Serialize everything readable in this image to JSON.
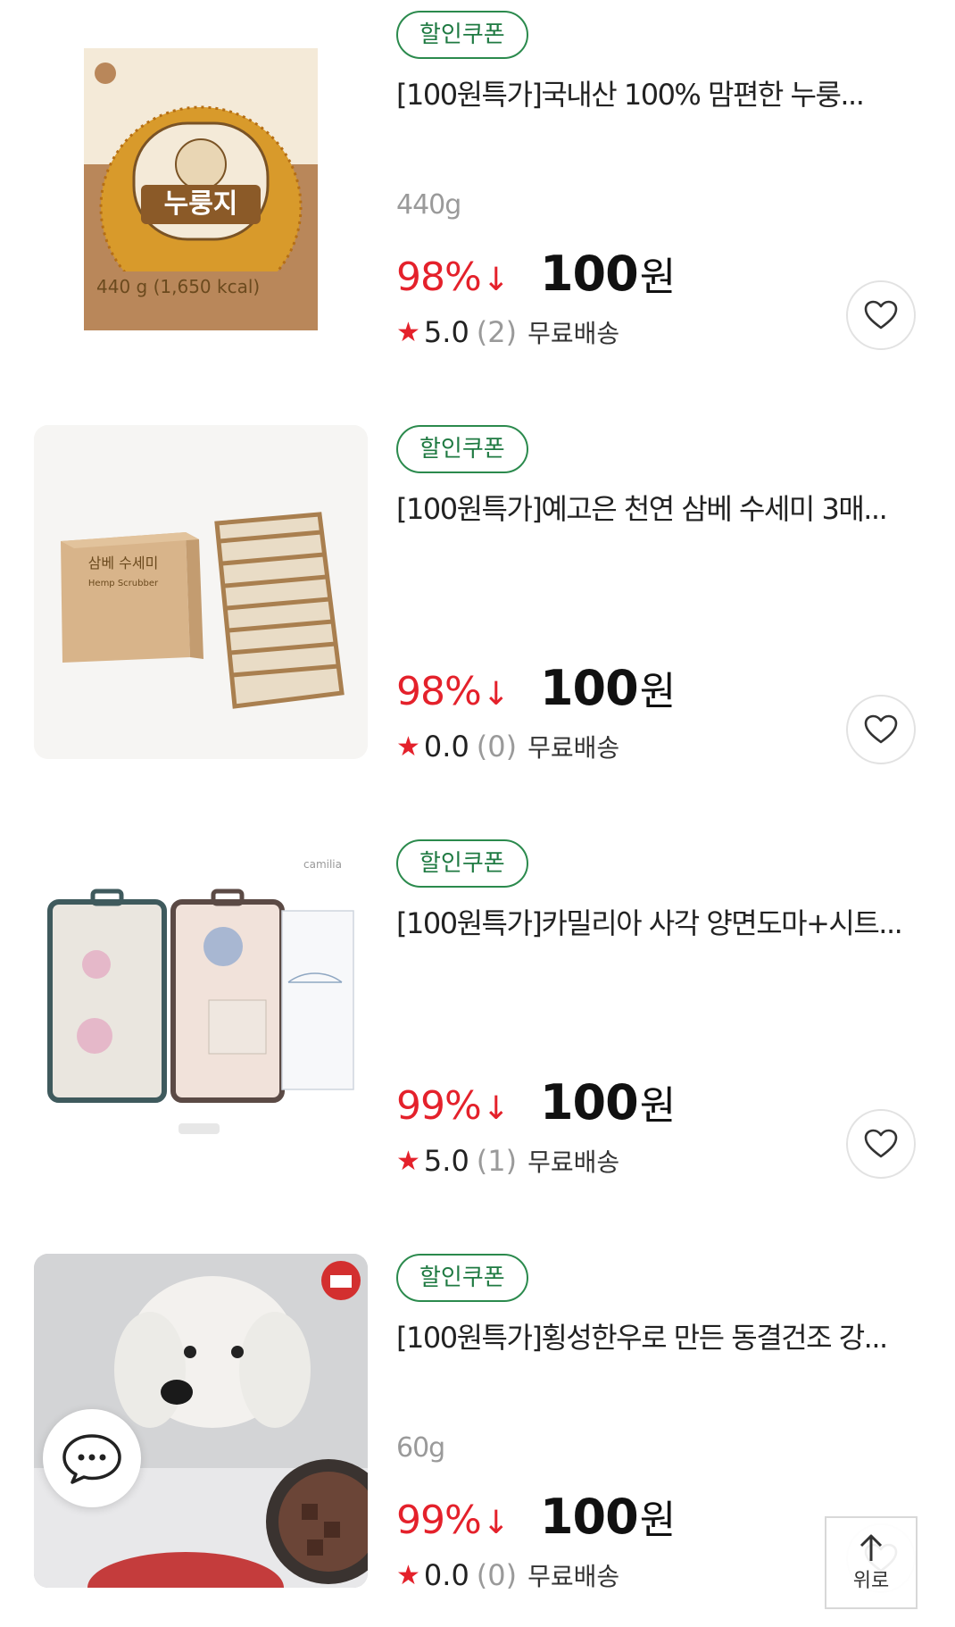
{
  "products": [
    {
      "coupon": "할인쿠폰",
      "title": "[100원특가]국내산 100% 맘편한 누룽...",
      "weight": "440g",
      "discount": "98%",
      "discount_arrow": "↓",
      "price": "100",
      "currency": "원",
      "star": "★",
      "rating": "5.0",
      "review_count": "(2)",
      "shipping": "무료배송",
      "image": {
        "label": "누룽지",
        "sub": "440 g (1,650 kcal)"
      }
    },
    {
      "coupon": "할인쿠폰",
      "title": "[100원특가]예고은 천연 삼베 수세미 3매...",
      "weight": "",
      "discount": "98%",
      "discount_arrow": "↓",
      "price": "100",
      "currency": "원",
      "star": "★",
      "rating": "0.0",
      "review_count": "(0)",
      "shipping": "무료배송",
      "image": {
        "label": "삼베 수세미",
        "sub": "Hemp Scrubber"
      }
    },
    {
      "coupon": "할인쿠폰",
      "title": "[100원특가]카밀리아 사각 양면도마+시트...",
      "weight": "",
      "discount": "99%",
      "discount_arrow": "↓",
      "price": "100",
      "currency": "원",
      "star": "★",
      "rating": "5.0",
      "review_count": "(1)",
      "shipping": "무료배송",
      "image": {
        "label": "camilia"
      }
    },
    {
      "coupon": "할인쿠폰",
      "title": "[100원특가]횡성한우로 만든 동결건조 강...",
      "weight": "60g",
      "discount": "99%",
      "discount_arrow": "↓",
      "price": "100",
      "currency": "원",
      "star": "★",
      "rating": "0.0",
      "review_count": "(0)",
      "shipping": "무료배송",
      "image": {
        "label": ""
      }
    }
  ],
  "scroll_top": {
    "label": "위로"
  },
  "icons": {
    "heart": "heart-icon",
    "chat": "chat-bubble-icon",
    "arrow_up": "arrow-up-icon"
  },
  "colors": {
    "discount": "#e4212b",
    "coupon": "#1f7a42",
    "muted": "#9a9a9a"
  }
}
